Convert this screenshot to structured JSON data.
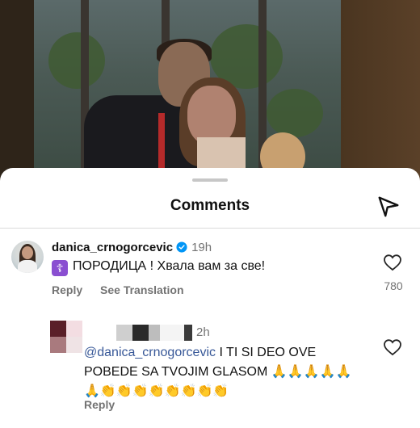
{
  "sheet": {
    "title": "Comments"
  },
  "icons": {
    "send": "send-icon",
    "verified": "verified-badge-icon",
    "heart": "heart-icon",
    "cross": "orthodox-cross-icon"
  },
  "colors": {
    "accent_blue": "#0095f6",
    "mention": "#385898",
    "muted": "#737373",
    "emoji_purple": "#8a4fd1"
  },
  "comments": [
    {
      "username": "danica_crnogorcevic",
      "verified": true,
      "time": "19h",
      "emoji": "☦",
      "text": "ПОРОДИЦА ! Хвала вам за све!",
      "reply_label": "Reply",
      "translate_label": "See Translation",
      "likes": "780"
    },
    {
      "username_redacted": true,
      "time": "2h",
      "mention": "@danica_crnogorcevic",
      "text": " I TI SI DEO OVE POBEDE SA TVOJIM GLASOM 🙏🙏🙏🙏🙏🙏👏👏👏👏👏👏👏👏",
      "reply_label": "Reply"
    }
  ]
}
